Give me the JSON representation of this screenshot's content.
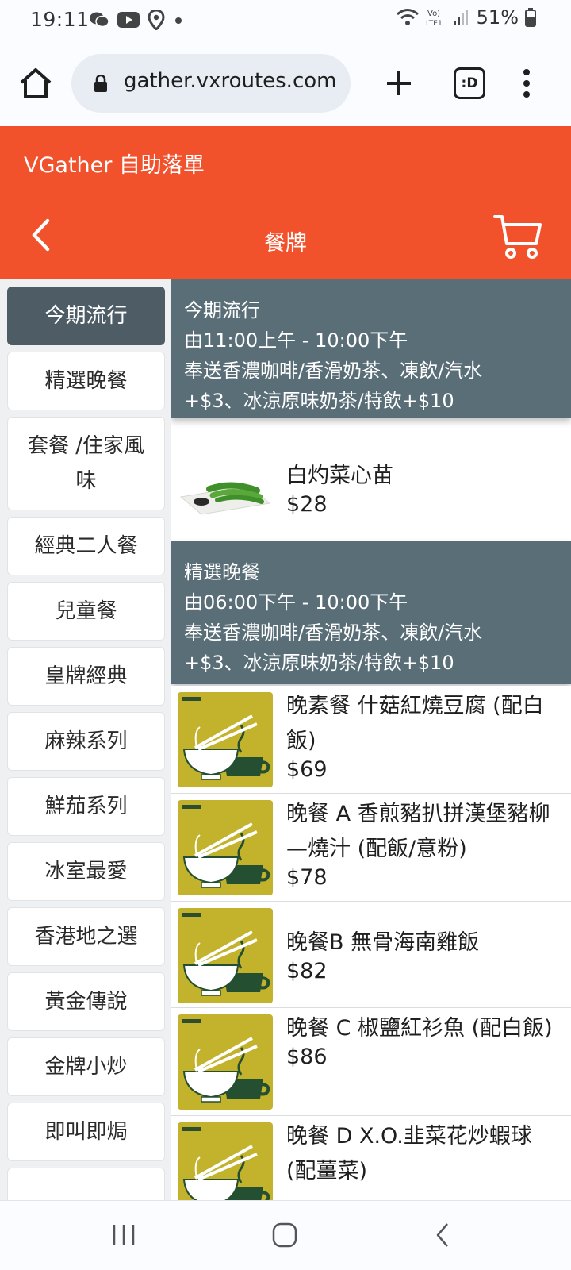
{
  "status": {
    "time": "19:11",
    "battery": "51%"
  },
  "browser": {
    "url": "gather.vxroutes.com",
    "tabs_label": ":D"
  },
  "header": {
    "app_title": "VGather 自助落單",
    "page_title": "餐牌"
  },
  "colors": {
    "brand": "#f1522c",
    "section_header": "#5a6e78",
    "active_category": "#4d5c65"
  },
  "sidebar": {
    "items": [
      {
        "label": "今期流行",
        "active": true
      },
      {
        "label": "精選晚餐"
      },
      {
        "label": "套餐 /住家風味"
      },
      {
        "label": "經典二人餐"
      },
      {
        "label": "兒童餐"
      },
      {
        "label": "皇牌經典"
      },
      {
        "label": "麻辣系列"
      },
      {
        "label": "鮮茄系列"
      },
      {
        "label": "冰室最愛"
      },
      {
        "label": "香港地之選"
      },
      {
        "label": "黃金傳說"
      },
      {
        "label": "金牌小炒"
      },
      {
        "label": "即叫即焗"
      }
    ]
  },
  "sections": [
    {
      "title": "今期流行",
      "hours": "由11:00上午 - 10:00下午",
      "promo1": "奉送香濃咖啡/香滑奶茶、凍飲/汽水",
      "promo2": "+$3、冰涼原味奶茶/特飲+$10",
      "items": [
        {
          "name": "白灼菜心苗",
          "price": "$28",
          "icon": "vegetable-photo"
        }
      ]
    },
    {
      "title": "精選晚餐",
      "hours": "由06:00下午 - 10:00下午",
      "promo1": "奉送香濃咖啡/香滑奶茶、凍飲/汽水",
      "promo2": "+$3、冰涼原味奶茶/特飲+$10",
      "items": [
        {
          "name": "晚素餐  什菇紅燒豆腐  (配白飯)",
          "price": "$69",
          "icon": "noodle-bowl-cup-logo"
        },
        {
          "name": "晚餐 A  香煎豬扒拼漢堡豬柳—燒汁 (配飯/意粉)",
          "price": "$78",
          "icon": "noodle-bowl-cup-logo"
        },
        {
          "name": "晚餐B 無骨海南雞飯",
          "price": "$82",
          "icon": "noodle-bowl-cup-logo"
        },
        {
          "name": "晚餐 C  椒鹽紅衫魚  (配白飯)",
          "price": "$86",
          "icon": "noodle-bowl-cup-logo"
        },
        {
          "name": "晚餐 D  X.O.韭菜花炒蝦球 (配薑菜)",
          "price": "",
          "icon": "noodle-bowl-cup-logo"
        }
      ]
    }
  ]
}
